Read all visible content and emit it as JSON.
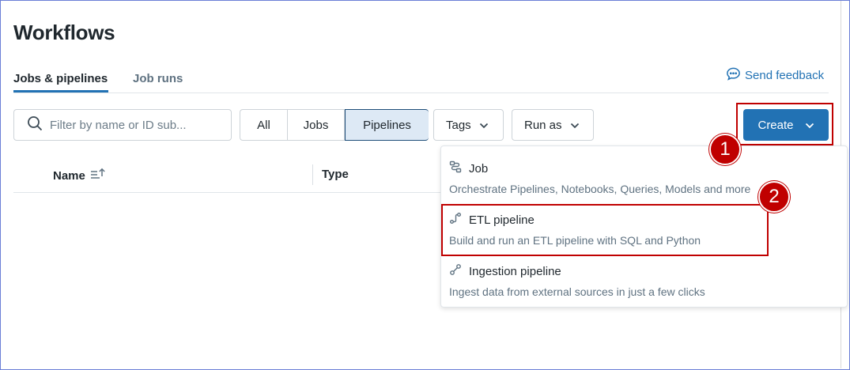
{
  "page": {
    "title": "Workflows"
  },
  "tabs": [
    {
      "label": "Jobs & pipelines",
      "active": true
    },
    {
      "label": "Job runs",
      "active": false
    }
  ],
  "feedback": {
    "label": "Send feedback",
    "icon": "chat-bubble-icon"
  },
  "toolbar": {
    "search_placeholder": "Filter by name or ID sub...",
    "search_icon": "search-icon",
    "segments": [
      {
        "label": "All",
        "selected": false
      },
      {
        "label": "Jobs",
        "selected": false
      },
      {
        "label": "Pipelines",
        "selected": true
      }
    ],
    "tags_label": "Tags",
    "run_as_label": "Run as",
    "create_label": "Create"
  },
  "table": {
    "columns": [
      {
        "label": "Name",
        "sort_icon": "sort-ascending-icon"
      },
      {
        "label": "Type"
      }
    ]
  },
  "create_menu": {
    "items": [
      {
        "title": "Job",
        "description": "Orchestrate Pipelines, Notebooks, Queries, Models and more",
        "icon": "workflow-icon"
      },
      {
        "title": "ETL pipeline",
        "description": "Build and run an ETL pipeline with SQL and Python",
        "icon": "pipeline-icon"
      },
      {
        "title": "Ingestion pipeline",
        "description": "Ingest data from external sources in just a few clicks",
        "icon": "ingestion-icon"
      }
    ]
  },
  "annotations": {
    "callout_1": "1",
    "callout_2": "2",
    "highlight_color": "#c00000"
  },
  "colors": {
    "accent": "#2272b4",
    "selected_segment_bg": "#dde9f5"
  }
}
